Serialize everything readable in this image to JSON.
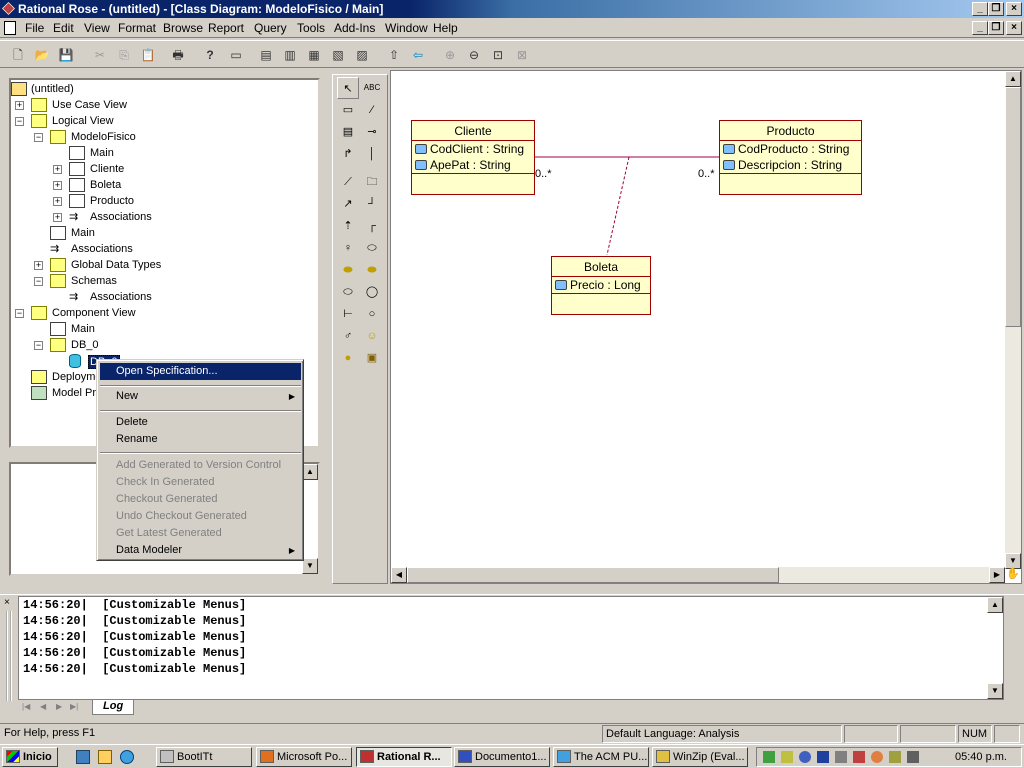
{
  "window": {
    "title": "Rational Rose - (untitled) - [Class Diagram: ModeloFisico / Main]"
  },
  "menu": [
    "File",
    "Edit",
    "View",
    "Format",
    "Browse",
    "Report",
    "Query",
    "Tools",
    "Add-Ins",
    "Window",
    "Help"
  ],
  "tree": {
    "root": "(untitled)",
    "items": [
      {
        "label": "Use Case View"
      },
      {
        "label": "Logical View"
      },
      {
        "label": "ModeloFisico"
      },
      {
        "label": "Main"
      },
      {
        "label": "Cliente"
      },
      {
        "label": "Boleta"
      },
      {
        "label": "Producto"
      },
      {
        "label": "Associations"
      },
      {
        "label": "Main"
      },
      {
        "label": "Associations"
      },
      {
        "label": "Global Data Types"
      },
      {
        "label": "Schemas"
      },
      {
        "label": "Associations"
      },
      {
        "label": "Component View"
      },
      {
        "label": "Main"
      },
      {
        "label": "DB_0"
      },
      {
        "label": "DB_0"
      },
      {
        "label": "Deployment View"
      },
      {
        "label": "Model Properties"
      }
    ]
  },
  "context_menu": {
    "items": [
      {
        "label": "Open Specification...",
        "state": "selected"
      },
      {
        "label": "New",
        "submenu": true
      },
      {
        "label": "Delete"
      },
      {
        "label": "Rename"
      },
      {
        "label": "Add  Generated to Version Control",
        "state": "disabled"
      },
      {
        "label": "Check In Generated",
        "state": "disabled"
      },
      {
        "label": "Checkout Generated",
        "state": "disabled"
      },
      {
        "label": "Undo Checkout Generated",
        "state": "disabled"
      },
      {
        "label": "Get Latest Generated",
        "state": "disabled"
      },
      {
        "label": "Data Modeler",
        "submenu": true
      }
    ]
  },
  "diagram": {
    "classes": [
      {
        "name": "Cliente",
        "attributes": [
          "CodClient : String",
          "ApePat : String"
        ]
      },
      {
        "name": "Producto",
        "attributes": [
          "CodProducto : String",
          "Descripcion : String"
        ]
      },
      {
        "name": "Boleta",
        "attributes": [
          "Precio : Long"
        ]
      }
    ],
    "multiplicities": [
      "0..*",
      "0..*"
    ]
  },
  "log": {
    "tab": "Log",
    "lines": [
      "14:56:20|  [Customizable Menus]",
      "14:56:20|  [Customizable Menus]",
      "14:56:20|  [Customizable Menus]",
      "14:56:20|  [Customizable Menus]",
      "14:56:20|  [Customizable Menus]"
    ]
  },
  "status": {
    "help": "For Help, press F1",
    "language": "Default Language: Analysis",
    "num": "NUM"
  },
  "taskbar": {
    "start": "Inicio",
    "tasks": [
      "BootITt",
      "Microsoft Po...",
      "Rational R...",
      "Documento1...",
      "The ACM PU...",
      "WinZip (Eval..."
    ],
    "clock": "05:40 p.m."
  },
  "palette_text": {
    "abc": "ABC"
  }
}
